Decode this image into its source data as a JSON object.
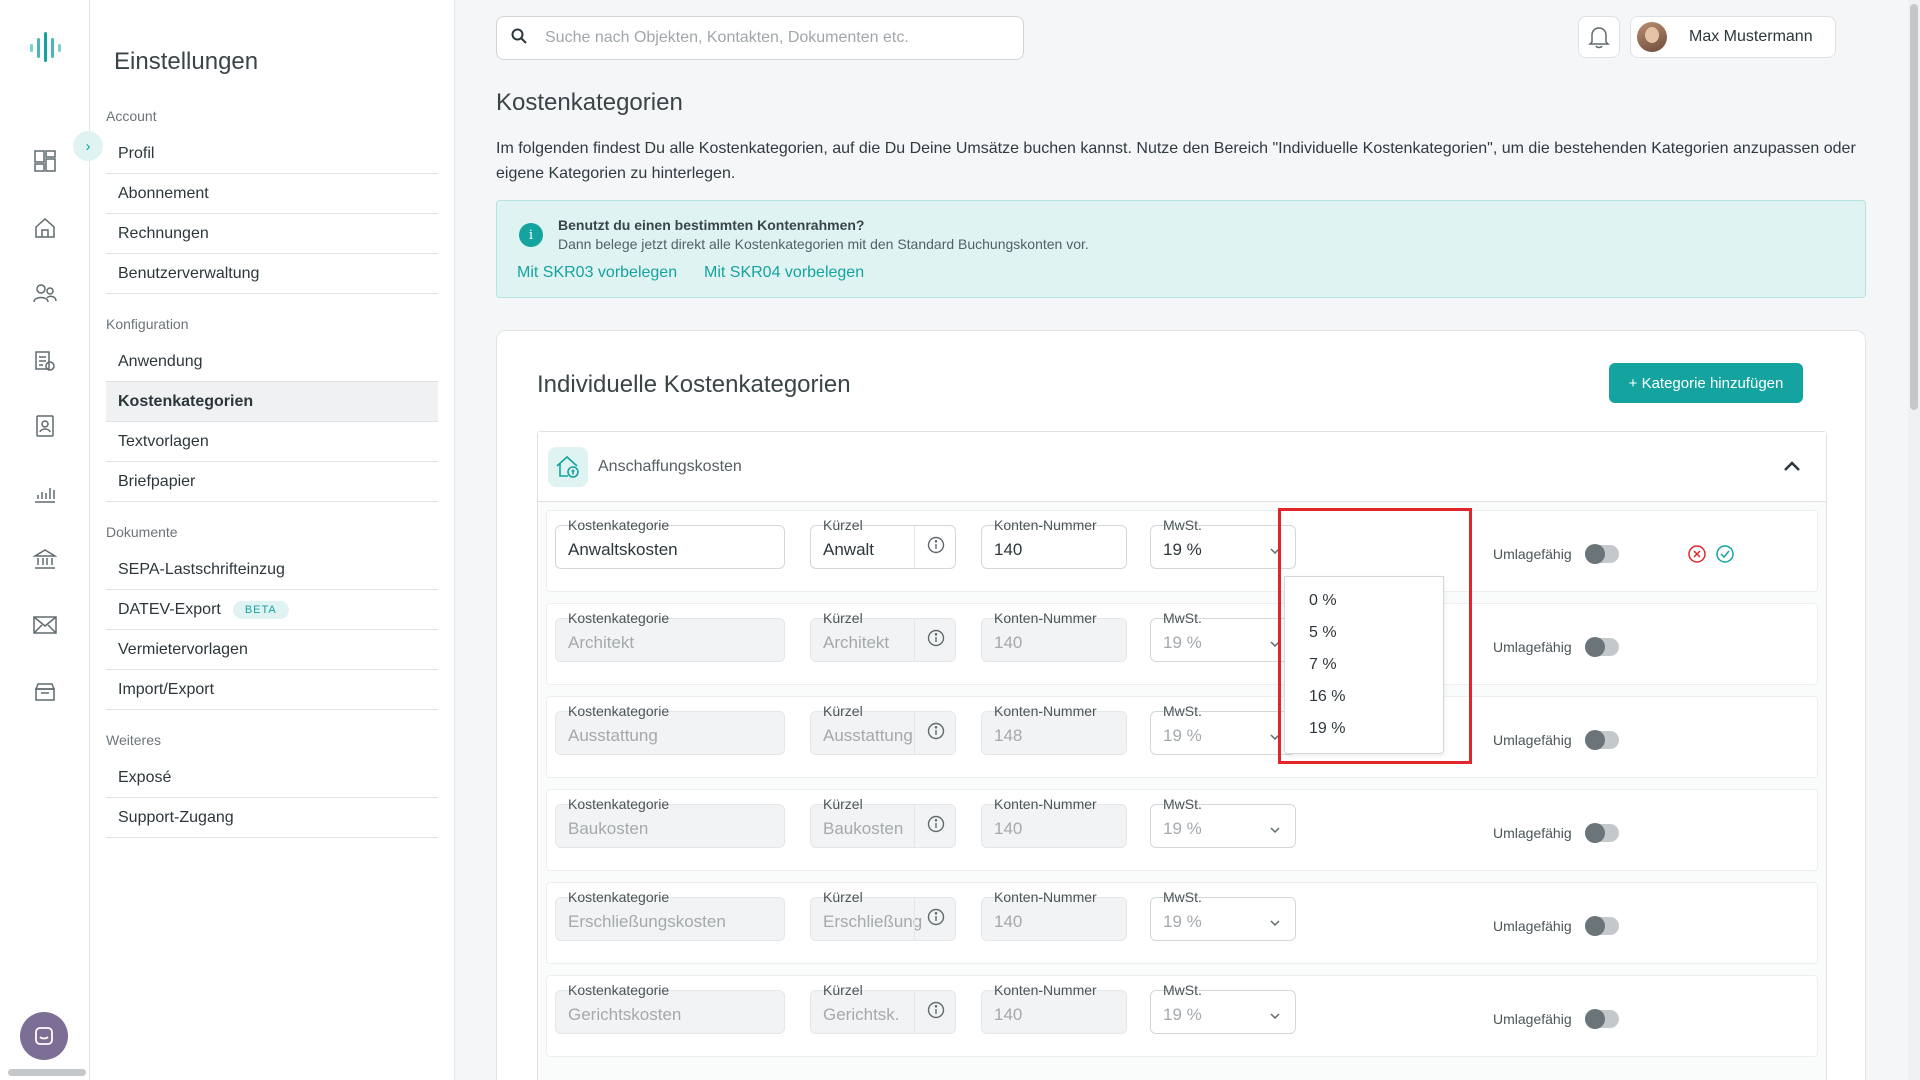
{
  "settings": {
    "title": "Einstellungen",
    "sections": [
      {
        "title": "Account",
        "items": [
          "Profil",
          "Abonnement",
          "Rechnungen",
          "Benutzerverwaltung"
        ]
      },
      {
        "title": "Konfiguration",
        "items": [
          "Anwendung",
          "Kostenkategorien",
          "Textvorlagen",
          "Briefpapier"
        ]
      },
      {
        "title": "Dokumente",
        "items": [
          "SEPA-Lastschrifteinzug",
          "DATEV-Export",
          "Vermietervorlagen",
          "Import/Export"
        ]
      },
      {
        "title": "Weiteres",
        "items": [
          "Exposé",
          "Support-Zugang"
        ]
      }
    ],
    "beta_badge": "BETA",
    "active_item": "Kostenkategorien"
  },
  "header": {
    "search_placeholder": "Suche nach Objekten, Kontakten, Dokumenten etc.",
    "user_name": "Max Mustermann"
  },
  "page": {
    "title": "Kostenkategorien",
    "intro": "Im folgenden findest Du alle Kostenkategorien, auf die Du Deine Umsätze buchen kannst. Nutze den Bereich \"Individuelle Kostenkategorien\", um die bestehenden Kategorien anzupassen oder eigene Kategorien zu hinterlegen.",
    "info_title": "Benutzt du einen bestimmten Kontenrahmen?",
    "info_text": "Dann belege jetzt direkt alle Kostenkategorien mit den Standard Buchungskonten vor.",
    "link_skr03": "Mit SKR03 vorbelegen",
    "link_skr04": "Mit SKR04 vorbelegen"
  },
  "card": {
    "title": "Individuelle Kostenkategorien",
    "add_button": "+ Kategorie hinzufügen",
    "group_label": "Anschaffungskosten",
    "labels": {
      "kategorie": "Kostenkategorie",
      "kuerzel": "Kürzel",
      "konto": "Konten-Nummer",
      "mwst": "MwSt.",
      "umlage": "Umlagefähig"
    },
    "rows": [
      {
        "kategorie": "Anwaltskosten",
        "kuerzel": "Anwalt",
        "konto": "140",
        "mwst": "19 %"
      },
      {
        "kategorie": "Architekt",
        "kuerzel": "Architekt",
        "konto": "140",
        "mwst": "19 %"
      },
      {
        "kategorie": "Ausstattung",
        "kuerzel": "Ausstattung",
        "konto": "148",
        "mwst": "19 %"
      },
      {
        "kategorie": "Baukosten",
        "kuerzel": "Baukosten",
        "konto": "140",
        "mwst": "19 %"
      },
      {
        "kategorie": "Erschließungskosten",
        "kuerzel": "Erschließung",
        "konto": "140",
        "mwst": "19 %"
      },
      {
        "kategorie": "Gerichtskosten",
        "kuerzel": "Gerichtsk.",
        "konto": "140",
        "mwst": "19 %"
      }
    ],
    "mwst_options": [
      "0 %",
      "5 %",
      "7 %",
      "16 %",
      "19 %"
    ]
  },
  "colors": {
    "accent": "#15a3a0",
    "highlight": "#e0262b"
  },
  "icons": [
    "logo-icon",
    "dashboard-icon",
    "home-icon",
    "contacts-icon",
    "documents-icon",
    "tenant-icon",
    "chart-icon",
    "bank-icon",
    "mail-icon",
    "archive-icon"
  ]
}
